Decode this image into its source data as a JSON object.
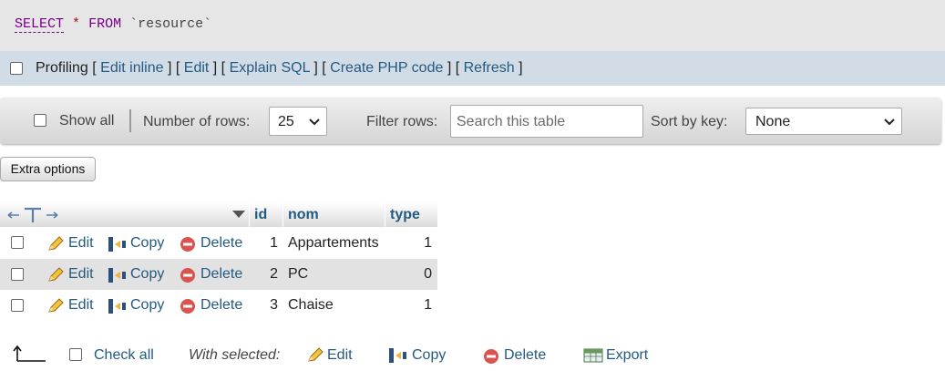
{
  "sql": {
    "select": "SELECT",
    "star": "*",
    "from": "FROM",
    "table": "`resource`"
  },
  "profiling": {
    "label": "Profiling",
    "links": [
      "Edit inline",
      "Edit",
      "Explain SQL",
      "Create PHP code",
      "Refresh"
    ]
  },
  "nav": {
    "show_all": "Show all",
    "rows_label": "Number of rows:",
    "rows_value": "25",
    "filter_label": "Filter rows:",
    "search_placeholder": "Search this table",
    "sort_label": "Sort by key:",
    "sort_value": "None"
  },
  "extra_options": "Extra options",
  "table": {
    "columns": [
      "id",
      "nom",
      "type"
    ],
    "actions": {
      "edit": "Edit",
      "copy": "Copy",
      "delete": "Delete"
    },
    "rows": [
      {
        "id": "1",
        "nom": "Appartements",
        "type": "1"
      },
      {
        "id": "2",
        "nom": "PC",
        "type": "0"
      },
      {
        "id": "3",
        "nom": "Chaise",
        "type": "1"
      }
    ]
  },
  "footer": {
    "check_all": "Check all",
    "with_selected": "With selected:",
    "edit": "Edit",
    "copy": "Copy",
    "delete": "Delete",
    "export": "Export"
  },
  "colors": {
    "link": "#235a81",
    "profiling_bar": "#d2dce6",
    "sql_bg": "#e6e6e6",
    "keyword": "#770088"
  }
}
